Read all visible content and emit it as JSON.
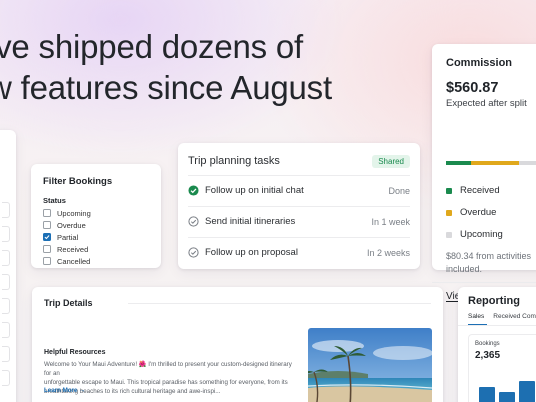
{
  "headline": {
    "line1": "’ve shipped dozens of",
    "line2": "w features since August"
  },
  "filter_bookings": {
    "title": "Filter Bookings",
    "status_label": "Status",
    "options": [
      {
        "label": "Upcoming",
        "checked": false
      },
      {
        "label": "Overdue",
        "checked": false
      },
      {
        "label": "Partial",
        "checked": true
      },
      {
        "label": "Received",
        "checked": false
      },
      {
        "label": "Cancelled",
        "checked": false
      }
    ]
  },
  "trip_planning": {
    "title": "Trip planning tasks",
    "badge": "Shared",
    "tasks": [
      {
        "label": "Follow up on initial chat",
        "meta": "Done",
        "done": true
      },
      {
        "label": "Send initial itineraries",
        "meta": "In 1 week",
        "done": false
      },
      {
        "label": "Follow up on proposal",
        "meta": "In 2 weeks",
        "done": false
      }
    ]
  },
  "commission": {
    "title": "Commission",
    "amount": "$560.87",
    "subtitle": "Expected after split",
    "legend": [
      {
        "label": "Received",
        "color": "#1a8a4e"
      },
      {
        "label": "Overdue",
        "color": "#e0a81c"
      },
      {
        "label": "Upcoming",
        "color": "#d9d9dc"
      }
    ],
    "split": [
      0.23,
      0.43,
      0.34
    ],
    "note_line1": "$80.34 from activities",
    "note_line2": "included.",
    "link": "View details"
  },
  "trip_details": {
    "title": "Trip Details",
    "resources_title": "Helpful Resources",
    "body_line1": "Welcome to Your Maui Adventure! 🌺 I'm thrilled to present your custom-designed itinerary for an",
    "body_line2": "unforgettable escape to Maui. This tropical paradise has something for everyone, from its",
    "body_line3": "breathtaking beaches to its rich cultural heritage and awe-inspi...",
    "learn_more": "Learn More →"
  },
  "reporting": {
    "title": "Reporting",
    "tabs": [
      "Sales",
      "Received Commi"
    ],
    "active_tab": 0,
    "metric_label": "Bookings",
    "metric_value": "2,365"
  },
  "colors": {
    "accent": "#1c6fb5",
    "green": "#1a8a4e",
    "yellow": "#e0a81c"
  }
}
